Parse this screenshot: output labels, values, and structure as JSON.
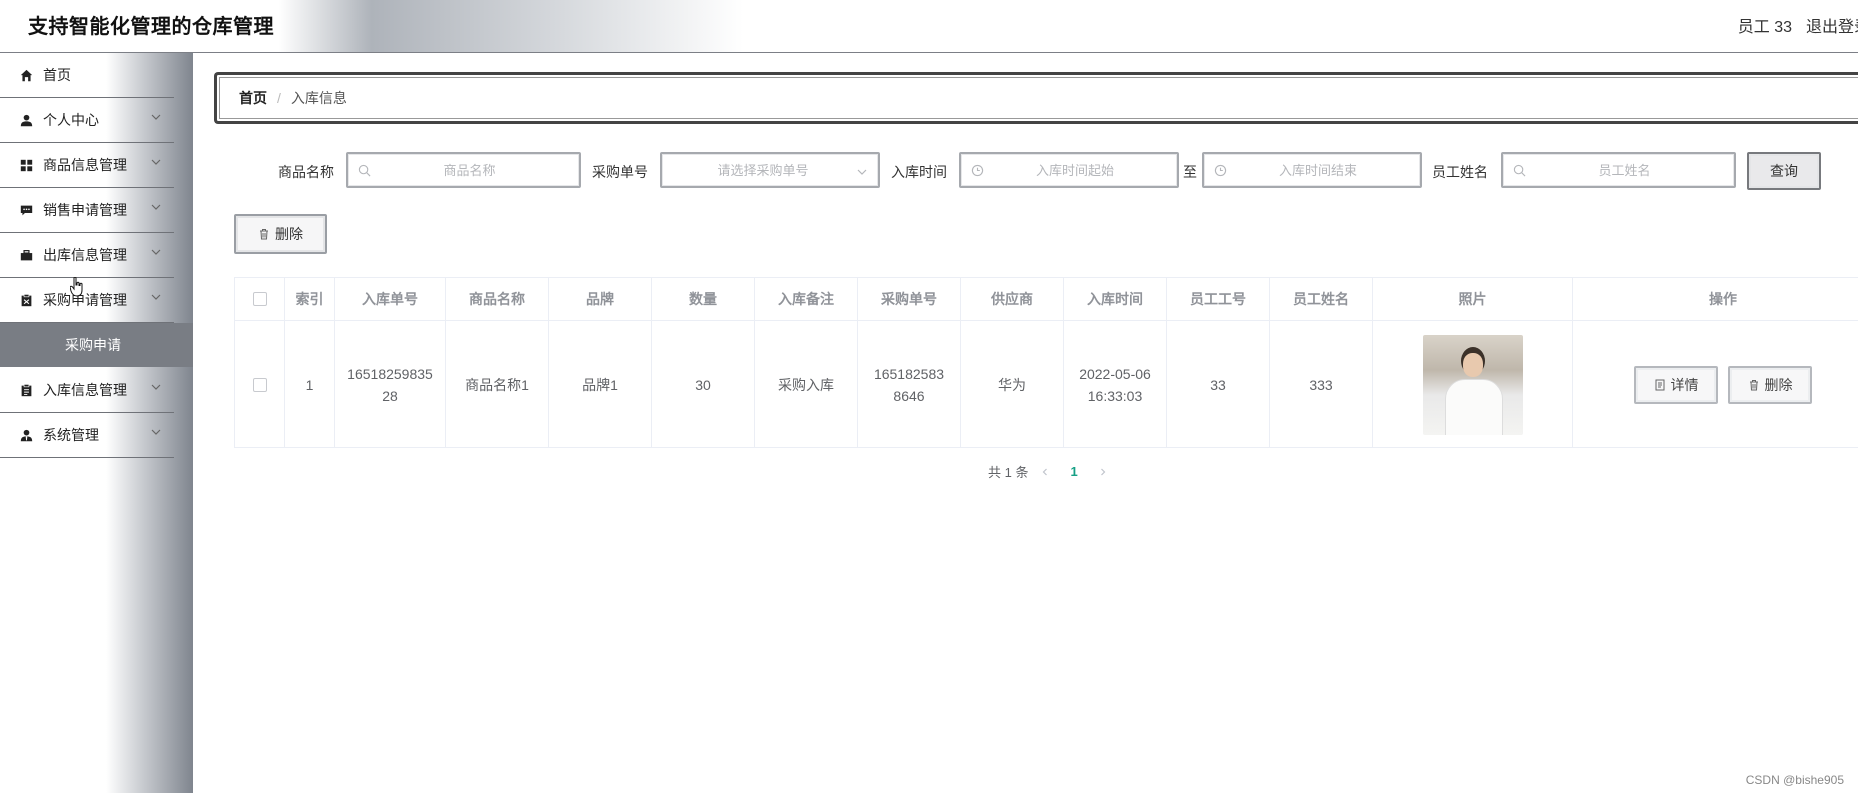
{
  "header": {
    "title": "支持智能化管理的仓库管理",
    "user": "员工 33",
    "logout": "退出登录"
  },
  "sidebar": {
    "items": [
      {
        "label": "首页",
        "icon": "home-icon"
      },
      {
        "label": "个人中心",
        "icon": "user-icon"
      },
      {
        "label": "商品信息管理",
        "icon": "grid-icon"
      },
      {
        "label": "销售申请管理",
        "icon": "comment-icon"
      },
      {
        "label": "出库信息管理",
        "icon": "briefcase-icon"
      },
      {
        "label": "采购申请管理",
        "icon": "clipboard-icon"
      },
      {
        "label": "采购申请",
        "icon": ""
      },
      {
        "label": "入库信息管理",
        "icon": "clipboard-icon"
      },
      {
        "label": "系统管理",
        "icon": "user-tie-icon"
      }
    ]
  },
  "breadcrumb": {
    "home": "首页",
    "separator": "/",
    "current": "入库信息"
  },
  "search": {
    "product_name_label": "商品名称",
    "product_name_placeholder": "商品名称",
    "purchase_no_label": "采购单号",
    "purchase_no_placeholder": "请选择采购单号",
    "time_label": "入库时间",
    "time_start_placeholder": "入库时间起始",
    "range_sep": "至",
    "time_end_placeholder": "入库时间结束",
    "employee_label": "员工姓名",
    "employee_placeholder": "员工姓名",
    "search_button": "查询"
  },
  "toolbar": {
    "delete_button": "删除"
  },
  "table": {
    "headers": [
      "索引",
      "入库单号",
      "商品名称",
      "品牌",
      "数量",
      "入库备注",
      "采购单号",
      "供应商",
      "入库时间",
      "员工工号",
      "员工姓名",
      "照片",
      "操作"
    ],
    "rows": [
      {
        "index": "1",
        "inbound_no_1": "16518259835",
        "inbound_no_2": "28",
        "product_name": "商品名称1",
        "brand": "品牌1",
        "quantity": "30",
        "remark": "采购入库",
        "purchase_no_1": "165182583",
        "purchase_no_2": "8646",
        "supplier": "华为",
        "date": "2022-05-06",
        "time": "16:33:03",
        "employee_id": "33",
        "employee_name": "333",
        "detail_button": "详情",
        "delete_button": "删除"
      }
    ]
  },
  "pagination": {
    "total": "共 1 条",
    "current_page": "1"
  },
  "watermark": "CSDN @bishe905",
  "colors": {
    "accent": "#16a085",
    "submenu_bg": "#797d84"
  }
}
